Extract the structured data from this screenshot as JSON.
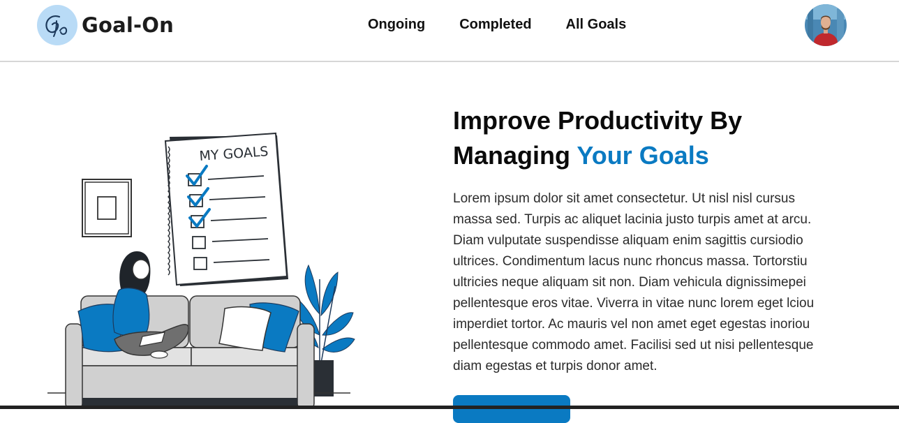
{
  "brand": {
    "name": "Goal-On",
    "accent_color": "#0a7ac2",
    "logo_bg_color": "#b9dbf6"
  },
  "nav": {
    "items": [
      {
        "label": "Ongoing"
      },
      {
        "label": "Completed"
      },
      {
        "label": "All Goals"
      }
    ]
  },
  "user": {
    "avatar_icon": "user-avatar-photo"
  },
  "illustration": {
    "board_title": "MY GOALS",
    "checklist": [
      true,
      true,
      true,
      false,
      false
    ]
  },
  "hero": {
    "title_line1": "Improve Productivity By",
    "title_line2_plain": "Managing ",
    "title_line2_accent": "Your Goals",
    "body": "Lorem ipsum dolor sit amet consectetur. Ut nisl nisl cursus massa sed. Turpis ac aliquet lacinia justo turpis amet at arcu. Diam vulputate suspendisse aliquam enim sagittis cursiodio ultrices. Condimentum lacus nunc rhoncus massa. Tortorstiu ultricies neque aliquam sit non. Diam vehicula dignissimepei pellentesque eros vitae. Viverra in vitae nunc lorem eget lciou imperdiet tortor. Ac mauris vel non amet eget egestas inoriou pellentesque commodo amet. Facilisi sed ut nisi pellentesque diam egestas et turpis donor amet.",
    "cta_label": ""
  }
}
